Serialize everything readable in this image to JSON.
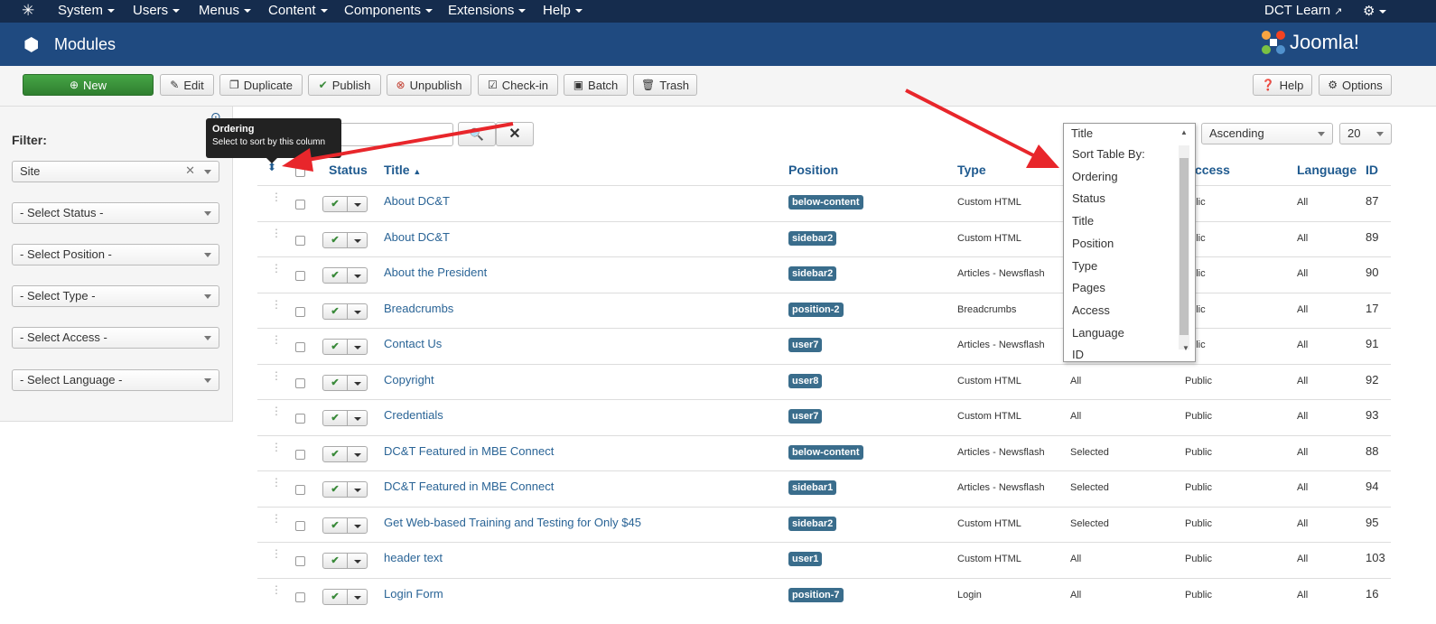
{
  "nav": {
    "items": [
      "System",
      "Users",
      "Menus",
      "Content",
      "Components",
      "Extensions",
      "Help"
    ],
    "site_link": "DCT Learn"
  },
  "page": {
    "title": "Modules",
    "logo_text": "Joomla!"
  },
  "toolbar": {
    "new": "New",
    "edit": "Edit",
    "duplicate": "Duplicate",
    "publish": "Publish",
    "unpublish": "Unpublish",
    "checkin": "Check-in",
    "batch": "Batch",
    "trash": "Trash",
    "help": "Help",
    "options": "Options"
  },
  "sidebar": {
    "filter_label": "Filter:",
    "site": "Site",
    "filters": [
      "- Select Status -",
      "- Select Position -",
      "- Select Type -",
      "- Select Access -",
      "- Select Language -"
    ]
  },
  "search": {
    "placeholder": "Search"
  },
  "sort": {
    "field": "Title",
    "order": "Ascending",
    "limit": "20",
    "options": [
      "Sort Table By:",
      "Ordering",
      "Status",
      "Title",
      "Position",
      "Type",
      "Pages",
      "Access",
      "Language",
      "ID"
    ]
  },
  "tooltip": {
    "title": "Ordering",
    "text": "Select to sort by this column"
  },
  "columns": {
    "status": "Status",
    "title": "Title",
    "position": "Position",
    "type": "Type",
    "access": "ccess",
    "language": "Language",
    "id": "ID"
  },
  "rows": [
    {
      "title": "About DC&T",
      "position": "below-content",
      "type": "Custom HTML",
      "pages": "",
      "access": "ublic",
      "language": "All",
      "id": "87"
    },
    {
      "title": "About DC&T",
      "position": "sidebar2",
      "type": "Custom HTML",
      "pages": "",
      "access": "ublic",
      "language": "All",
      "id": "89"
    },
    {
      "title": "About the President",
      "position": "sidebar2",
      "type": "Articles - Newsflash",
      "pages": "",
      "access": "ublic",
      "language": "All",
      "id": "90"
    },
    {
      "title": "Breadcrumbs",
      "position": "position-2",
      "type": "Breadcrumbs",
      "pages": "",
      "access": "ublic",
      "language": "All",
      "id": "17"
    },
    {
      "title": "Contact Us",
      "position": "user7",
      "type": "Articles - Newsflash",
      "pages": "",
      "access": "ublic",
      "language": "All",
      "id": "91"
    },
    {
      "title": "Copyright",
      "position": "user8",
      "type": "Custom HTML",
      "pages": "All",
      "access": "Public",
      "language": "All",
      "id": "92"
    },
    {
      "title": "Credentials",
      "position": "user7",
      "type": "Custom HTML",
      "pages": "All",
      "access": "Public",
      "language": "All",
      "id": "93"
    },
    {
      "title": "DC&T Featured in MBE Connect",
      "position": "below-content",
      "type": "Articles - Newsflash",
      "pages": "Selected",
      "access": "Public",
      "language": "All",
      "id": "88"
    },
    {
      "title": "DC&T Featured in MBE Connect",
      "position": "sidebar1",
      "type": "Articles - Newsflash",
      "pages": "Selected",
      "access": "Public",
      "language": "All",
      "id": "94"
    },
    {
      "title": "Get Web-based Training and Testing for Only $45",
      "position": "sidebar2",
      "type": "Custom HTML",
      "pages": "Selected",
      "access": "Public",
      "language": "All",
      "id": "95"
    },
    {
      "title": "header text",
      "position": "user1",
      "type": "Custom HTML",
      "pages": "All",
      "access": "Public",
      "language": "All",
      "id": "103"
    },
    {
      "title": "Login Form",
      "position": "position-7",
      "type": "Login",
      "pages": "All",
      "access": "Public",
      "language": "All",
      "id": "16"
    }
  ],
  "colors": {
    "navbar": "#152c4d",
    "header": "#1f4a80",
    "link": "#2a6496",
    "badge": "#3a6d8c",
    "arrow": "#e8262b"
  }
}
